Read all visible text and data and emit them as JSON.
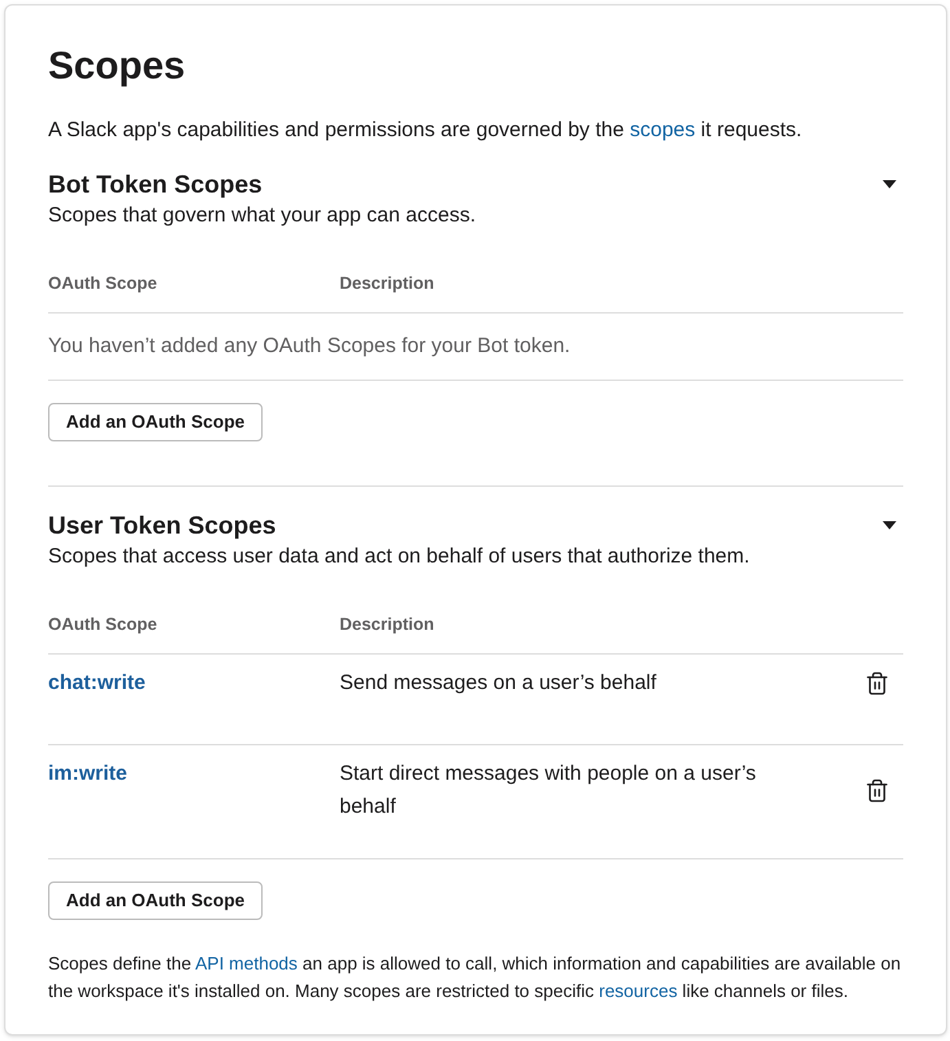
{
  "title": "Scopes",
  "intro": [
    {
      "kind": "text",
      "text": "A Slack app's capabilities and permissions are governed by the "
    },
    {
      "kind": "link",
      "text": "scopes"
    },
    {
      "kind": "text",
      "text": " it requests."
    }
  ],
  "sections": [
    {
      "title": "Bot Token Scopes",
      "subtitle": "Scopes that govern what your app can access.",
      "expanded": true,
      "columns": [
        "OAuth Scope",
        "Description"
      ],
      "empty_message": "You haven’t added any OAuth Scopes for your Bot token.",
      "button": "Add an OAuth Scope"
    },
    {
      "title": "User Token Scopes",
      "subtitle": "Scopes that access user data and act on behalf of users that authorize them.",
      "expanded": true,
      "columns": [
        "OAuth Scope",
        "Description"
      ],
      "rows": [
        {
          "scope": "chat:write",
          "description": "Send messages on a user’s behalf"
        },
        {
          "scope": "im:write",
          "description": "Start direct messages with people on a user’s behalf"
        }
      ],
      "button": "Add an OAuth Scope"
    }
  ],
  "footer": [
    {
      "kind": "text",
      "text": "Scopes define the "
    },
    {
      "kind": "link",
      "text": "API methods"
    },
    {
      "kind": "text",
      "text": " an app is allowed to call, which information and capabilities are available on the workspace it's installed on. Many scopes are restricted to specific "
    },
    {
      "kind": "link",
      "text": "resources"
    },
    {
      "kind": "text",
      "text": " like channels or files."
    }
  ]
}
